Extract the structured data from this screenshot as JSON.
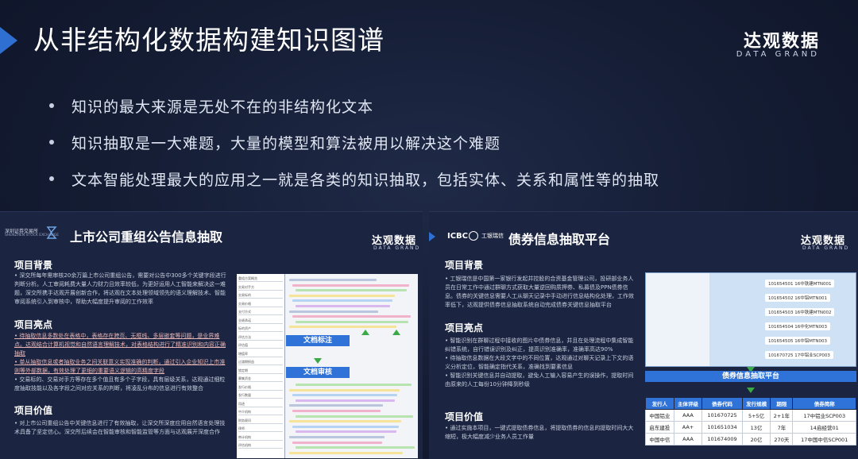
{
  "header": {
    "title": "从非结构化数据构建知识图谱",
    "brand_cn": "达观数据",
    "brand_en": "DATA GRAND"
  },
  "bullets": [
    "知识的最大来源是无处不在的非结构化文本",
    "知识抽取是一大难题，大量的模型和算法被用以解决这个难题",
    "文本智能处理最大的应用之一就是各类的知识抽取，包括实体、关系和属性等的抽取"
  ],
  "left_panel": {
    "logo_line1": "深圳证券交易所",
    "logo_line2": "SHENZHEN STOCK EXCHANGE",
    "title": "上市公司重组公告信息抽取",
    "brand_cn": "达观数据",
    "brand_en": "DATA GRAND",
    "sec1_title": "项目背景",
    "sec1_text": "• 深交所每年需审核20余万篇上市公司重组公告，需要对公告中300多个关键字段进行判断分析。人工审阅耗费大量人力财力且效率较低，为更好运用人工智能来解决这一难题，深交所携手达观开展创新合作，将达观在文本处理领域领先的语义理解技术、智能审阅系统引入到审核中，帮助大幅度提升审阅的工作效率",
    "sec2_title": "项目亮点",
    "sec2_items": [
      "• 待抽取信息多数处在表格中，表格存在跨页、无框线、多层嵌套等问题，是业界难点。达观结合计算机视觉和自然语言理解技术，对表格结构进行了精准识别和内容正确抽取",
      "• 单从抽取信息或者抽取业务之间关联意义实现准确的判断，通过引入企业知识上市准则等外部数据，有效处理了更细的重要语义逻辑的高精度字段",
      "• 交易标的、交易对手方等存在多个值且有多个子字段，具有层级关系，达观通过细粒度抽取技能以及各字段之间对应关系的判断，将凌乱分布的信息进行有效整合"
    ],
    "sec3_title": "项目价值",
    "sec3_text": "• 对上市公司重组公告中关键信息进行了有效抽取，让深交所深度应用自然语言处理技术具备了坚定信心。深交所后续会在智能审核和智能监管等方面与达观展开深度合作",
    "doc_tag1": "文档标注",
    "doc_tag2": "文档审核",
    "doc_cells": [
      "重组方案概览",
      "交易对手方",
      "交易标的",
      "交易价格",
      "支付方式",
      "业绩承诺",
      "标的资产",
      "评估方法",
      "评估值",
      "增值率",
      "过渡期损益",
      "锁定期",
      "募集资金",
      "发行价格",
      "发行数量",
      "用途",
      "中介机构",
      "财务顾问",
      "律师",
      "审计机构",
      "评估机构"
    ]
  },
  "right_panel": {
    "logo_en": "ICBC",
    "logo_cn": "工银瑞信",
    "title": "债券信息抽取平台",
    "brand_cn": "达观数据",
    "brand_en": "DATA GRAND",
    "sec1_title": "项目背景",
    "sec1_text": "• 工银瑞信是中国第一家银行发起并控股的合资基金管理公司，投研部业务人员在日常工作中通过群聊方式获取大量逆回购质押券、私募债及PPN债券信息。债券的关键信息需要人工从聊天记录中手动进行信息结构化处理，工作效率低下，达观提供债券信息抽取系统自动完成债券关键信息抽取平台",
    "sec2_title": "项目亮点",
    "sec2_items": [
      "• 智能识别在群聊过程中接收的图片中债券信息，并且在处理流程中集成智能纠错系统，自行错误识别及纠正，提高识别准确率，准确率高达90%",
      "• 待抽取信息数据在大段文字中的不同位置，达观通过对聊天记录上下文的语义分析定位，智能确定指代关系，准确找到要素信息",
      "• 智能识别关键信息并自动提取，避免人工输入容易产生的误操作，提取时间由原来的人工每份10分钟降到秒级"
    ],
    "sec3_title": "项目价值",
    "sec3_text": "• 通过实施本项目，一键式提取债券信息，将提取债券的信息的提取时间大大缩短，极大幅度减少业务人员工作量",
    "chat_messages": [
      "101654501 16中铁建MTN001",
      "101654502 16中铝MTN001",
      "101654503 16中铁建MTN002",
      "101654504 16中化MTN003",
      "101654505 16中铝MTN003",
      "101670725 17中铝业SCP003"
    ],
    "platform_label": "债券信息抽取平台",
    "table_headers": [
      "发行人",
      "主体评级",
      "债券代码",
      "发行规模",
      "期限",
      "债券简称"
    ],
    "table_rows": [
      [
        "中国铝业",
        "AAA",
        "101670725",
        "5+5亿",
        "2+1年",
        "17中铝业SCP003"
      ],
      [
        "启东建投",
        "AA+",
        "101651034",
        "13亿",
        "7年",
        "14启经营01"
      ],
      [
        "中国中信",
        "AAA",
        "101674009",
        "20亿",
        "270天",
        "17中国中信SCP001"
      ]
    ]
  }
}
